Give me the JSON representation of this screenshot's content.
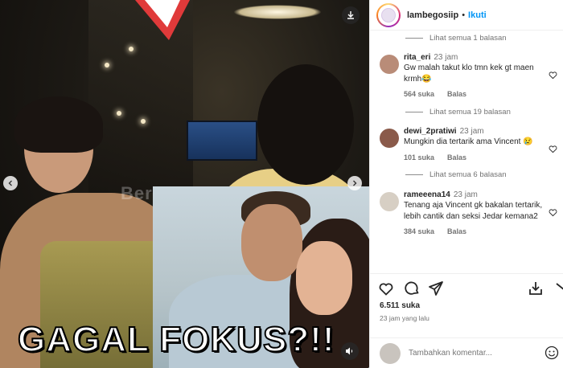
{
  "media": {
    "caption": "GAGAL FOKUS?!!",
    "watermark": "BeritaTerkini",
    "icons": [
      "play-badge-icon",
      "download-icon",
      "chevron-left-icon",
      "chevron-right-icon",
      "mute-icon"
    ]
  },
  "header": {
    "username": "lambegosiip",
    "separator": "•",
    "follow_label": "Ikuti"
  },
  "comments": {
    "replies_top": "Lihat semua 1 balasan",
    "items": [
      {
        "user": "rita_eri",
        "time": "23 jam",
        "text": "Gw malah takut klo tmn kek gt maen krmh😂",
        "likes": "564 suka",
        "reply_label": "Balas",
        "avatar_color": "#b98c78",
        "replies_after": "Lihat semua 19 balasan"
      },
      {
        "user": "dewi_2pratiwi",
        "time": "23 jam",
        "text": "Mungkin dia tertarik ama Vincent 😢",
        "likes": "101 suka",
        "reply_label": "Balas",
        "avatar_color": "#8a5a4a",
        "replies_after": "Lihat semua 6 balasan"
      },
      {
        "user": "rameeena14",
        "time": "23 jam",
        "text": "Tenang aja Vincent gk bakalan tertarik, lebih cantik dan seksi Jedar kemana2",
        "likes": "384 suka",
        "reply_label": "Balas",
        "avatar_color": "#d7cfc4"
      }
    ]
  },
  "actions": {
    "likes": "6.511 suka",
    "timestamp": "23 jam yang lalu",
    "icons": [
      "heart-icon",
      "comment-icon",
      "share-icon",
      "save-icon"
    ]
  },
  "add_comment": {
    "placeholder": "Tambahkan komentar..."
  },
  "colors": {
    "accent": "#0095f6",
    "muted": "#737373"
  }
}
